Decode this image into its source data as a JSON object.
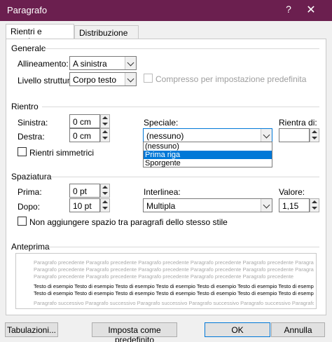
{
  "window": {
    "title": "Paragrafo",
    "help": "?",
    "close": "✕"
  },
  "tabs": [
    {
      "label": "Rientri e spaziatura",
      "active": true
    },
    {
      "label": "Distribuzione testo",
      "active": false
    }
  ],
  "generale": {
    "title": "Generale",
    "alignment_label": "Allineamento:",
    "alignment_value": "A sinistra",
    "outline_label": "Livello struttura:",
    "outline_value": "Corpo testo",
    "collapsed_label": "Compresso per impostazione predefinita"
  },
  "rientro": {
    "title": "Rientro",
    "left_label": "Sinistra:",
    "left_value": "0 cm",
    "right_label": "Destra:",
    "right_value": "0 cm",
    "special_label": "Speciale:",
    "special_value": "(nessuno)",
    "special_options": [
      "(nessuno)",
      "Prima riga",
      "Sporgente"
    ],
    "special_selected_index": 1,
    "by_label": "Rientra di:",
    "by_value": "",
    "mirror_label": "Rientri simmetrici"
  },
  "spaziatura": {
    "title": "Spaziatura",
    "before_label": "Prima:",
    "before_value": "0 pt",
    "after_label": "Dopo:",
    "after_value": "10 pt",
    "line_label": "Interlinea:",
    "line_value": "Multipla",
    "at_label": "Valore:",
    "at_value": "1,15",
    "no_space_label": "Non aggiungere spazio tra paragrafi dello stesso stile"
  },
  "anteprima": {
    "title": "Anteprima",
    "prev_line1": "Paragrafo precedente Paragrafo precedente Paragrafo precedente Paragrafo precedente Paragrafo precedente Paragrafo precedente",
    "prev_line2": "Paragrafo precedente Paragrafo precedente Paragrafo precedente Paragrafo precedente Paragrafo precedente Paragrafo precedente",
    "prev_line3": "Paragrafo precedente Paragrafo precedente Paragrafo precedente Paragrafo precedente Paragrafo precedente",
    "sample_line1": "Testo di esempio Testo di esempio Testo di esempio Testo di esempio Testo di esempio Testo di esempio Testo di esempio",
    "sample_line2": "Testo di esempio Testo di esempio Testo di esempio Testo di esempio Testo di esempio Testo di esempio Testo di esempio",
    "next_line1": "Paragrafo successivo Paragrafo successivo Paragrafo successivo Paragrafo successivo Paragrafo successivo Paragrafo successivo"
  },
  "buttons": {
    "tabs": "Tabulazioni...",
    "default": "Imposta come predefinito",
    "ok": "OK",
    "cancel": "Annulla"
  },
  "colors": {
    "titlebar": "#6b1f4f",
    "selection": "#0078d7"
  }
}
